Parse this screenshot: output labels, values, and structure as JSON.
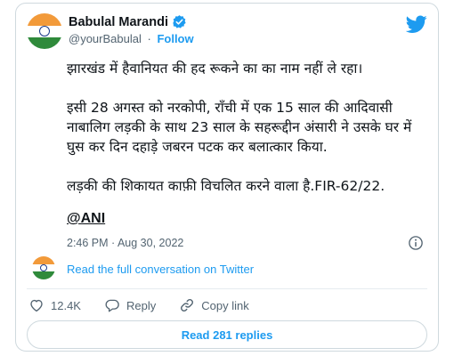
{
  "author": {
    "name": "Babulal Marandi",
    "handle": "@yourBabulal",
    "separator": "·",
    "follow_label": "Follow"
  },
  "tweet": {
    "line1": "झारखंड में हैवानियत की हद रूकने का का नाम नहीं ले रहा।",
    "para2": "इसी 28 अगस्त को नरकोपी, राँची में एक 15 साल की आदिवासी नाबालिग लड़की के साथ 23 साल के सहरूद्दीन अंसारी ने उसके घर में घुस कर दिन दहाड़े जबरन पटक कर बलात्कार किया.",
    "para3": "लड़की की शिकायत काफ़ी विचलित करने वाला है.FIR-62/22.",
    "mention": "@ANI",
    "timestamp": "2:46 PM · Aug 30, 2022"
  },
  "thread": {
    "label": "Read the full conversation on Twitter"
  },
  "actions": {
    "likes": "12.4K",
    "reply_label": "Reply",
    "copy_link_label": "Copy link"
  },
  "replies_button": "Read 281 replies",
  "colors": {
    "accent": "#1d9bf0",
    "text": "#0f1419",
    "muted": "#536471",
    "border": "#cfd9de"
  },
  "icons": [
    "verified-icon",
    "twitter-bird-icon",
    "info-icon",
    "heart-icon",
    "reply-icon",
    "link-icon"
  ]
}
